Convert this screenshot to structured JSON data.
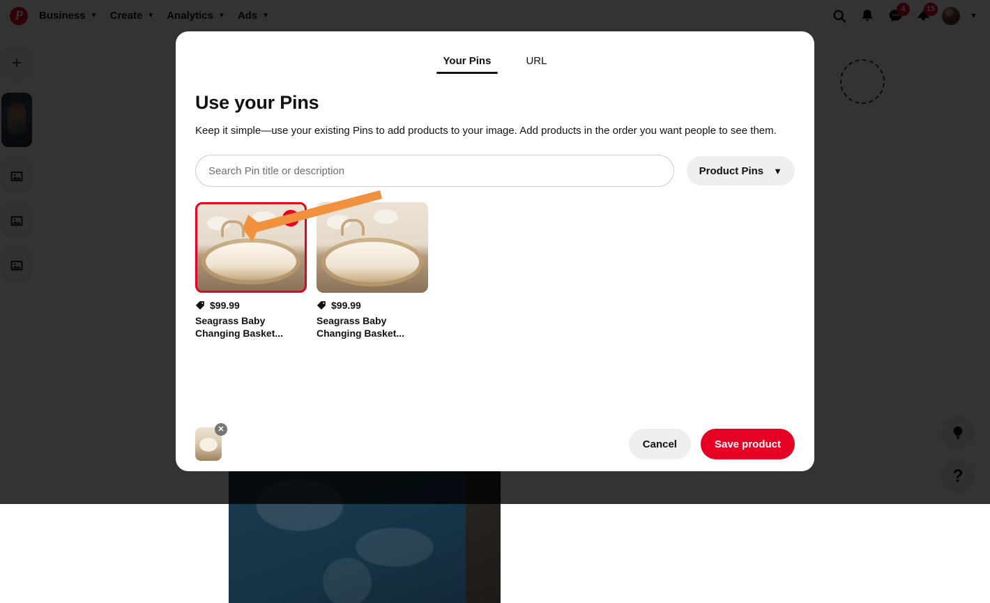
{
  "nav": {
    "logo_icon": "pinterest-logo-icon",
    "items": [
      {
        "label": "Business",
        "chevron": "⌄"
      },
      {
        "label": "Create",
        "chevron": "⌄"
      },
      {
        "label": "Analytics",
        "chevron": "⌄"
      },
      {
        "label": "Ads",
        "chevron": "⌄"
      }
    ],
    "right_icons": [
      {
        "name": "search-icon",
        "badge": ""
      },
      {
        "name": "bell-icon",
        "badge": ""
      },
      {
        "name": "messages-icon",
        "badge": "4"
      },
      {
        "name": "ads-alert-icon",
        "badge": "15"
      }
    ],
    "avatar_name": "user-avatar",
    "account_chevron": "⌄"
  },
  "sidebar": {
    "add_label": "+",
    "items": [
      {
        "name": "sidebar-thumb-photo",
        "icon": "photo-thumbnail"
      },
      {
        "name": "sidebar-slot-1",
        "icon": "image-placeholder-icon"
      },
      {
        "name": "sidebar-slot-2",
        "icon": "image-placeholder-icon"
      },
      {
        "name": "sidebar-slot-3",
        "icon": "image-placeholder-icon"
      }
    ]
  },
  "fab": {
    "idea_icon": "lightbulb-icon",
    "help_icon": "question-mark-icon",
    "help_label": "?"
  },
  "modal": {
    "tabs": [
      {
        "label": "Your Pins",
        "active": true
      },
      {
        "label": "URL",
        "active": false
      }
    ],
    "title": "Use your Pins",
    "description": "Keep it simple—use your existing Pins to add products to your image. Add products in the order you want people to see them.",
    "search": {
      "placeholder": "Search Pin title or description",
      "value": ""
    },
    "filter": {
      "label": "Product Pins",
      "chevron": "❯"
    },
    "pins": [
      {
        "price": "$99.99",
        "title": "Seagrass Baby Changing Basket...",
        "selected": true,
        "order_badge": "1"
      },
      {
        "price": "$99.99",
        "title": "Seagrass Baby Changing Basket...",
        "selected": false,
        "order_badge": ""
      }
    ],
    "footer": {
      "selected_thumb_name": "selected-product-thumbnail",
      "remove_label": "✕",
      "cancel_label": "Cancel",
      "save_label": "Save product"
    }
  },
  "colors": {
    "brand_red": "#e60023",
    "annotation_orange": "#f2913d",
    "scrim": "rgba(0,0,0,0.80)",
    "chip_gray": "#efefef"
  }
}
